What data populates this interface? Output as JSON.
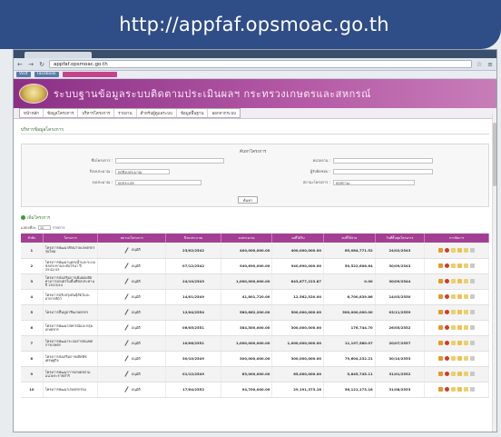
{
  "banner": {
    "url_text": "http://appfaf.opsmoac.go.th"
  },
  "browser": {
    "address": "appfaf.opsmoac.go.th",
    "bookmark_1": "Visit",
    "bookmark_2": "Facebook"
  },
  "site": {
    "title": "ระบบฐานข้อมูลระบบติดตามประเมินผลฯ กระทรวงเกษตรและสหกรณ์",
    "menu": [
      "หน้าหลัก",
      "ข้อมูลโครงการ",
      "บริหารโครงการ",
      "รายงาน",
      "สำหรับผู้ดูแลระบบ",
      "ข้อมูลพื้นฐาน",
      "ออกจากระบบ"
    ]
  },
  "page": {
    "heading": "บริหารข้อมูลโครงการ",
    "search": {
      "title": "ค้นหาโครงการ",
      "project_name_label": "ชื่อโครงการ :",
      "year_label": "ปีงบประมาณ :",
      "year_value": "ทุกปีงบประมาณ",
      "agency_label": "หน่วยงาน :",
      "agency_value": "ทุกหน่วยงาน",
      "status_label": "สถานะโครงการ :",
      "status_value": "ทุกสถานะ",
      "budget_label": "งบประมาณ :",
      "budget_value": "ทุกประเภท",
      "responsible_label": "ผู้รับผิดชอบ :",
      "search_button": "ค้นหา"
    },
    "add_project": "เพิ่มโครงการ",
    "page_size_label": "แสดงทีละ",
    "page_size_value": "10",
    "page_size_suffix": "รายการ"
  },
  "table": {
    "headers": [
      "ลำดับ",
      "โครงการ",
      "สถานะโครงการ",
      "ปีงบประมาณ",
      "งบประมาณ",
      "งบที่ได้รับ",
      "งบที่ใช้จ่าย",
      "วันที่สิ้นสุดโครงการ",
      "การจัดการ"
    ],
    "rows": [
      {
        "no": "1",
        "project": "โครงการพัฒนาศักยภาพเกษตรกรรุ่นใหม่",
        "status": "อนุมัติ",
        "date": "23/02/2542",
        "budget": "400,000,000.00",
        "received": "400,000,000.00",
        "spent": "65,084,771.52",
        "end_date": "24/02/2543"
      },
      {
        "no": "2",
        "project": "โครงการพัฒนาแหล่งน้ำและระบบชลประทานระดับไร่นา ปี 2542/43",
        "status": "อนุมัติ",
        "date": "07/12/2542",
        "budget": "940,690,000.00",
        "received": "940,690,000.00",
        "spent": "50,522,606.64",
        "end_date": "30/09/2543"
      },
      {
        "no": "3",
        "project": "โครงการส่งเสริมการเพิ่มผลผลิตทางการเกษตรในพื้นที่ชลประทาน ปี 2543/44",
        "status": "อนุมัติ",
        "date": "24/10/2543",
        "budget": "1,000,000,000.00",
        "received": "843,677,223.87",
        "spent": "0.00",
        "end_date": "30/09/2544"
      },
      {
        "no": "4",
        "project": "โครงการปรับปรุงพันธุ์สัตว์และอาหารสัตว์",
        "status": "อนุมัติ",
        "date": "14/01/2549",
        "budget": "41,801,720.00",
        "received": "12,562,520.00",
        "spent": "6,700,839.86",
        "end_date": "14/03/2550"
      },
      {
        "no": "5",
        "project": "โครงการฟื้นฟูอาชีพเกษตรกร",
        "status": "อนุมัติ",
        "date": "12/04/2554",
        "budget": "580,662,200.00",
        "received": "500,000,000.00",
        "spent": "500,000,000.00",
        "end_date": "03/11/2559"
      },
      {
        "no": "6",
        "project": "โครงการพัฒนาสหกรณ์และกลุ่มเกษตรกร",
        "status": "อนุมัติ",
        "date": "06/05/2551",
        "budget": "384,500,000.00",
        "received": "300,000,000.00",
        "spent": "176,744.70",
        "end_date": "26/05/2552"
      },
      {
        "no": "7",
        "project": "โครงการพัฒนาระบบสารสนเทศการเกษตร",
        "status": "อนุมัติ",
        "date": "10/06/2551",
        "budget": "1,000,000,000.00",
        "received": "1,000,000,000.00",
        "spent": "11,197,580.07",
        "end_date": "20/07/2557"
      },
      {
        "no": "8",
        "project": "โครงการส่งเสริมการผลิตพืชเศรษฐกิจ",
        "status": "อนุมัติ",
        "date": "30/10/2549",
        "budget": "300,000,000.00",
        "received": "300,000,000.00",
        "spent": "79,604,232.21",
        "end_date": "30/10/2553"
      },
      {
        "no": "9",
        "project": "โครงการพัฒนาการเกษตรตามแนวพระราชดำริ",
        "status": "อนุมัติ",
        "date": "01/12/2549",
        "budget": "65,000,000.00",
        "received": "65,000,000.00",
        "spent": "5,845,745.11",
        "end_date": "31/01/2552"
      },
      {
        "no": "10",
        "project": "โครงการพัฒนาเกษตรกรรม",
        "status": "อนุมัติ",
        "date": "17/04/2552",
        "budget": "94,700,000.00",
        "received": "29,191,373.16",
        "spent": "56,121,173.16",
        "end_date": "31/08/2553"
      }
    ]
  },
  "colors": {
    "banner": "#2f4d86",
    "header": "#a23f93",
    "accent_green": "#3b7d2e"
  }
}
